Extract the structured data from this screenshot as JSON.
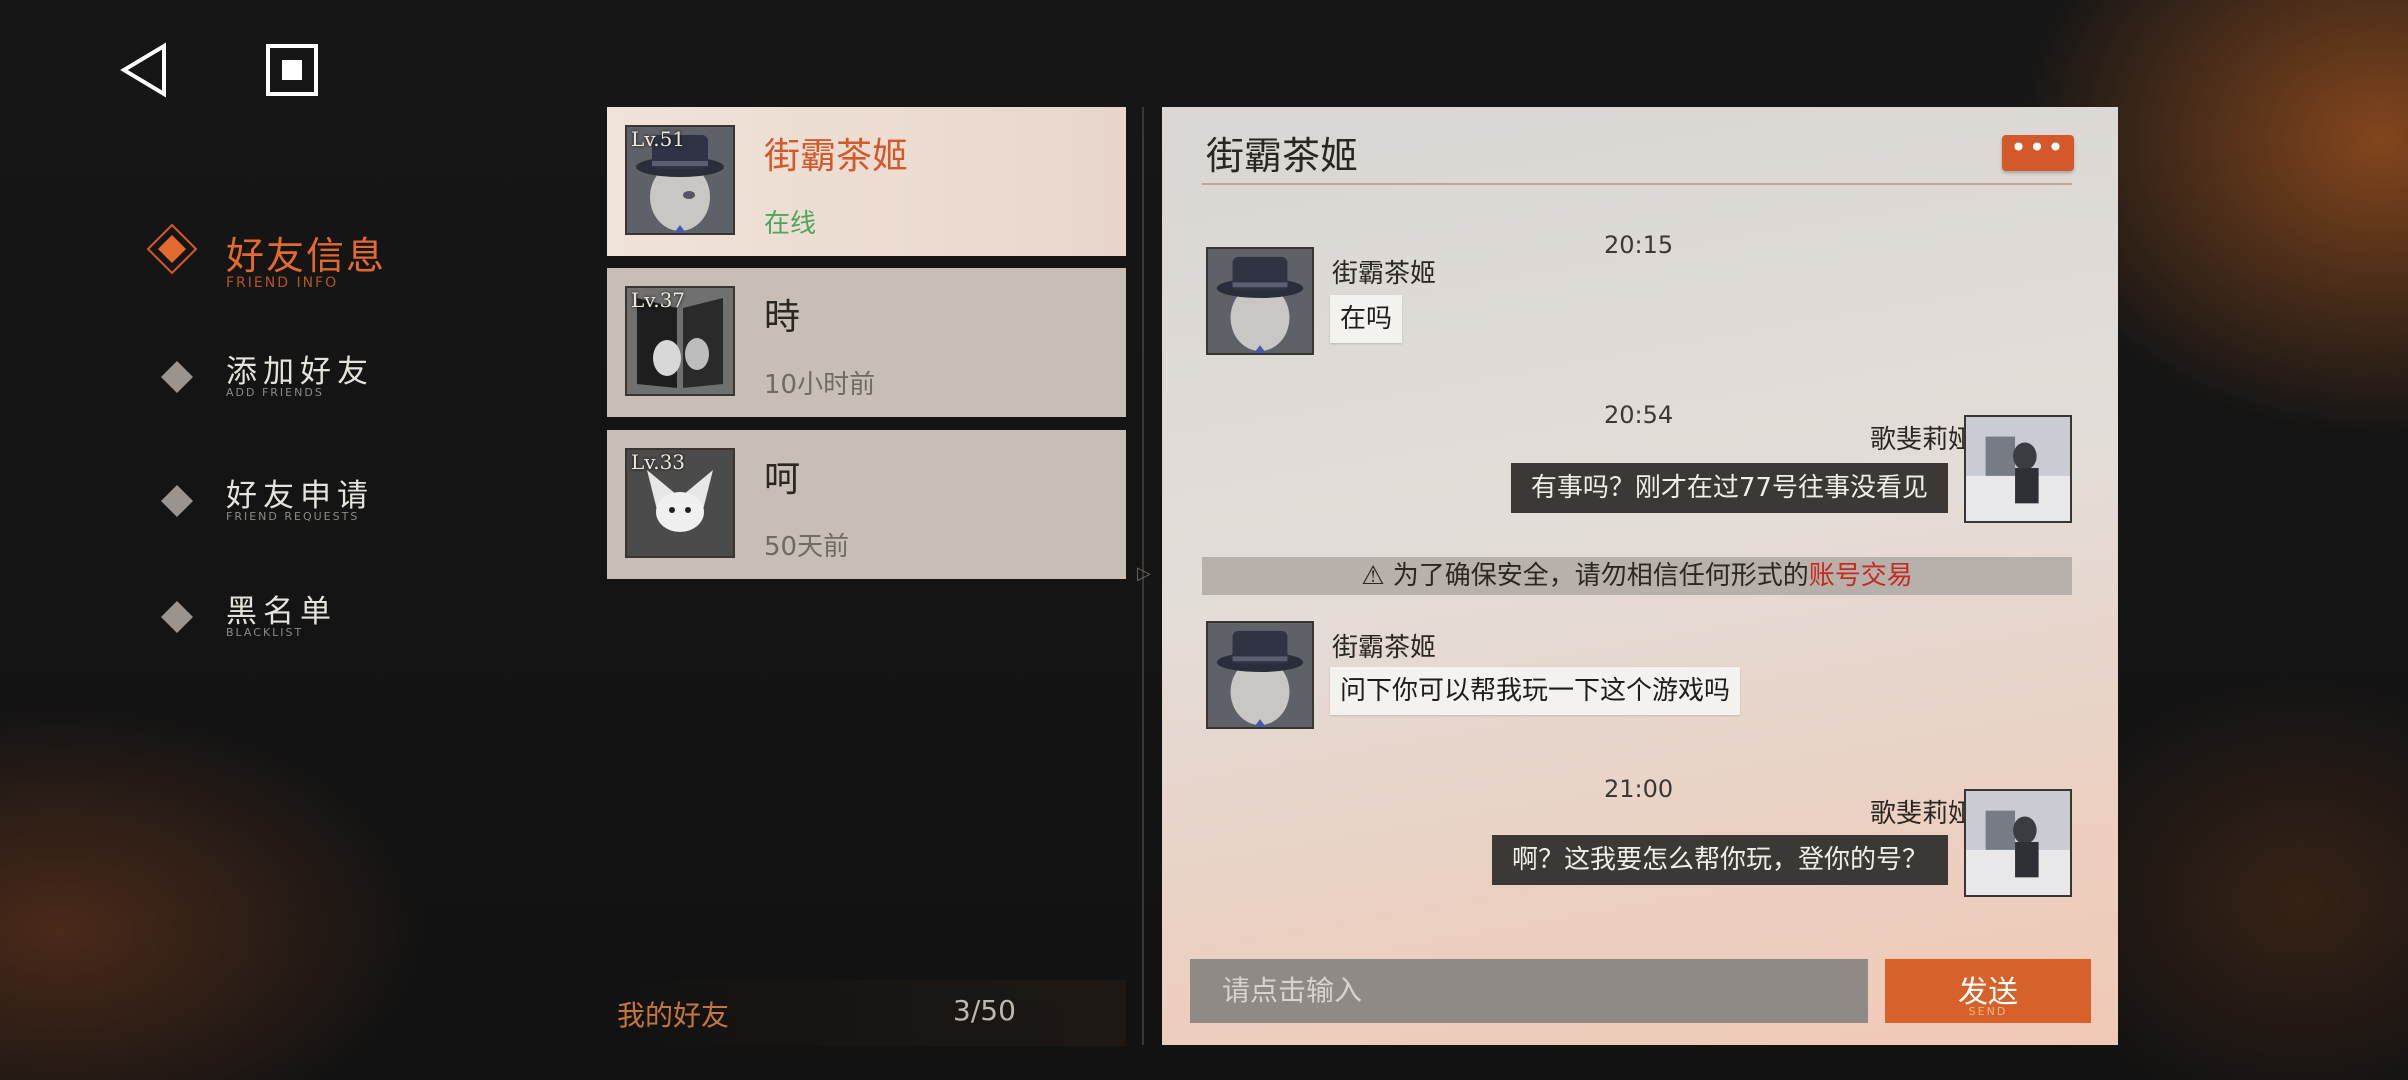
{
  "nav": {
    "main": {
      "title": "好友信息",
      "subtitle": "FRIEND INFO"
    },
    "items": [
      {
        "title": "添加好友",
        "subtitle": "ADD FRIENDS"
      },
      {
        "title": "好友申请",
        "subtitle": "FRIEND REQUESTS"
      },
      {
        "title": "黑名单",
        "subtitle": "BLACKLIST"
      }
    ]
  },
  "friends": [
    {
      "level": "Lv.51",
      "name": "街霸茶姬",
      "status": "在线",
      "selected": true
    },
    {
      "level": "Lv.37",
      "name": "時",
      "status": "10小时前"
    },
    {
      "level": "Lv.33",
      "name": "呵",
      "status": "50天前"
    }
  ],
  "friends_footer": {
    "label": "我的好友",
    "count": "3/50"
  },
  "chat": {
    "title": "街霸茶姬",
    "more_label": "•••",
    "messages": [
      {
        "time": "20:15",
        "sender": "街霸茶姬",
        "text": "在吗",
        "direction": "in"
      },
      {
        "time": "20:54",
        "sender": "歌斐莉娅",
        "text": "有事吗？刚才在过77号往事没看见",
        "direction": "out"
      },
      {
        "time": "",
        "sender": "街霸茶姬",
        "text": "问下你可以帮我玩一下这个游戏吗",
        "direction": "in"
      },
      {
        "time": "21:00",
        "sender": "歌斐莉娅",
        "text": "啊？这我要怎么帮你玩，登你的号？",
        "direction": "out"
      }
    ],
    "warning": {
      "text": "为了确保安全，请勿相信任何形式的",
      "highlight": "账号交易"
    },
    "input_placeholder": "请点击输入",
    "send": {
      "label": "发送",
      "sub": "SEND"
    }
  },
  "colors": {
    "accent": "#d4592a",
    "online": "#4fa55a",
    "warning": "#c52a1f"
  }
}
